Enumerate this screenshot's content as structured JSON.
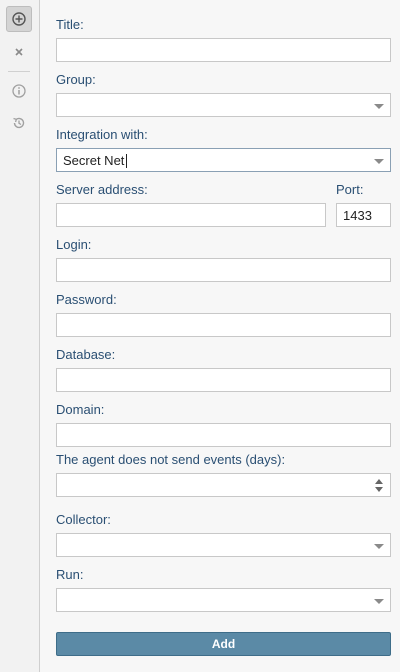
{
  "toolbar": {
    "icons": [
      "add-icon",
      "close-icon",
      "info-icon",
      "history-icon"
    ]
  },
  "form": {
    "title_label": "Title:",
    "title_value": "",
    "group_label": "Group:",
    "group_value": "",
    "integration_label": "Integration with:",
    "integration_value": "Secret Net",
    "server_label": "Server address:",
    "server_value": "",
    "port_label": "Port:",
    "port_value": "1433",
    "login_label": "Login:",
    "login_value": "",
    "password_label": "Password:",
    "password_value": "",
    "database_label": "Database:",
    "database_value": "",
    "domain_label": "Domain:",
    "domain_value": "",
    "agent_label": "The agent does not send events (days):",
    "agent_value": "",
    "collector_label": "Collector:",
    "collector_value": "",
    "run_label": "Run:",
    "run_value": "",
    "add_label": "Add"
  },
  "colors": {
    "label": "#2a4f73",
    "button": "#5b8aa6"
  }
}
